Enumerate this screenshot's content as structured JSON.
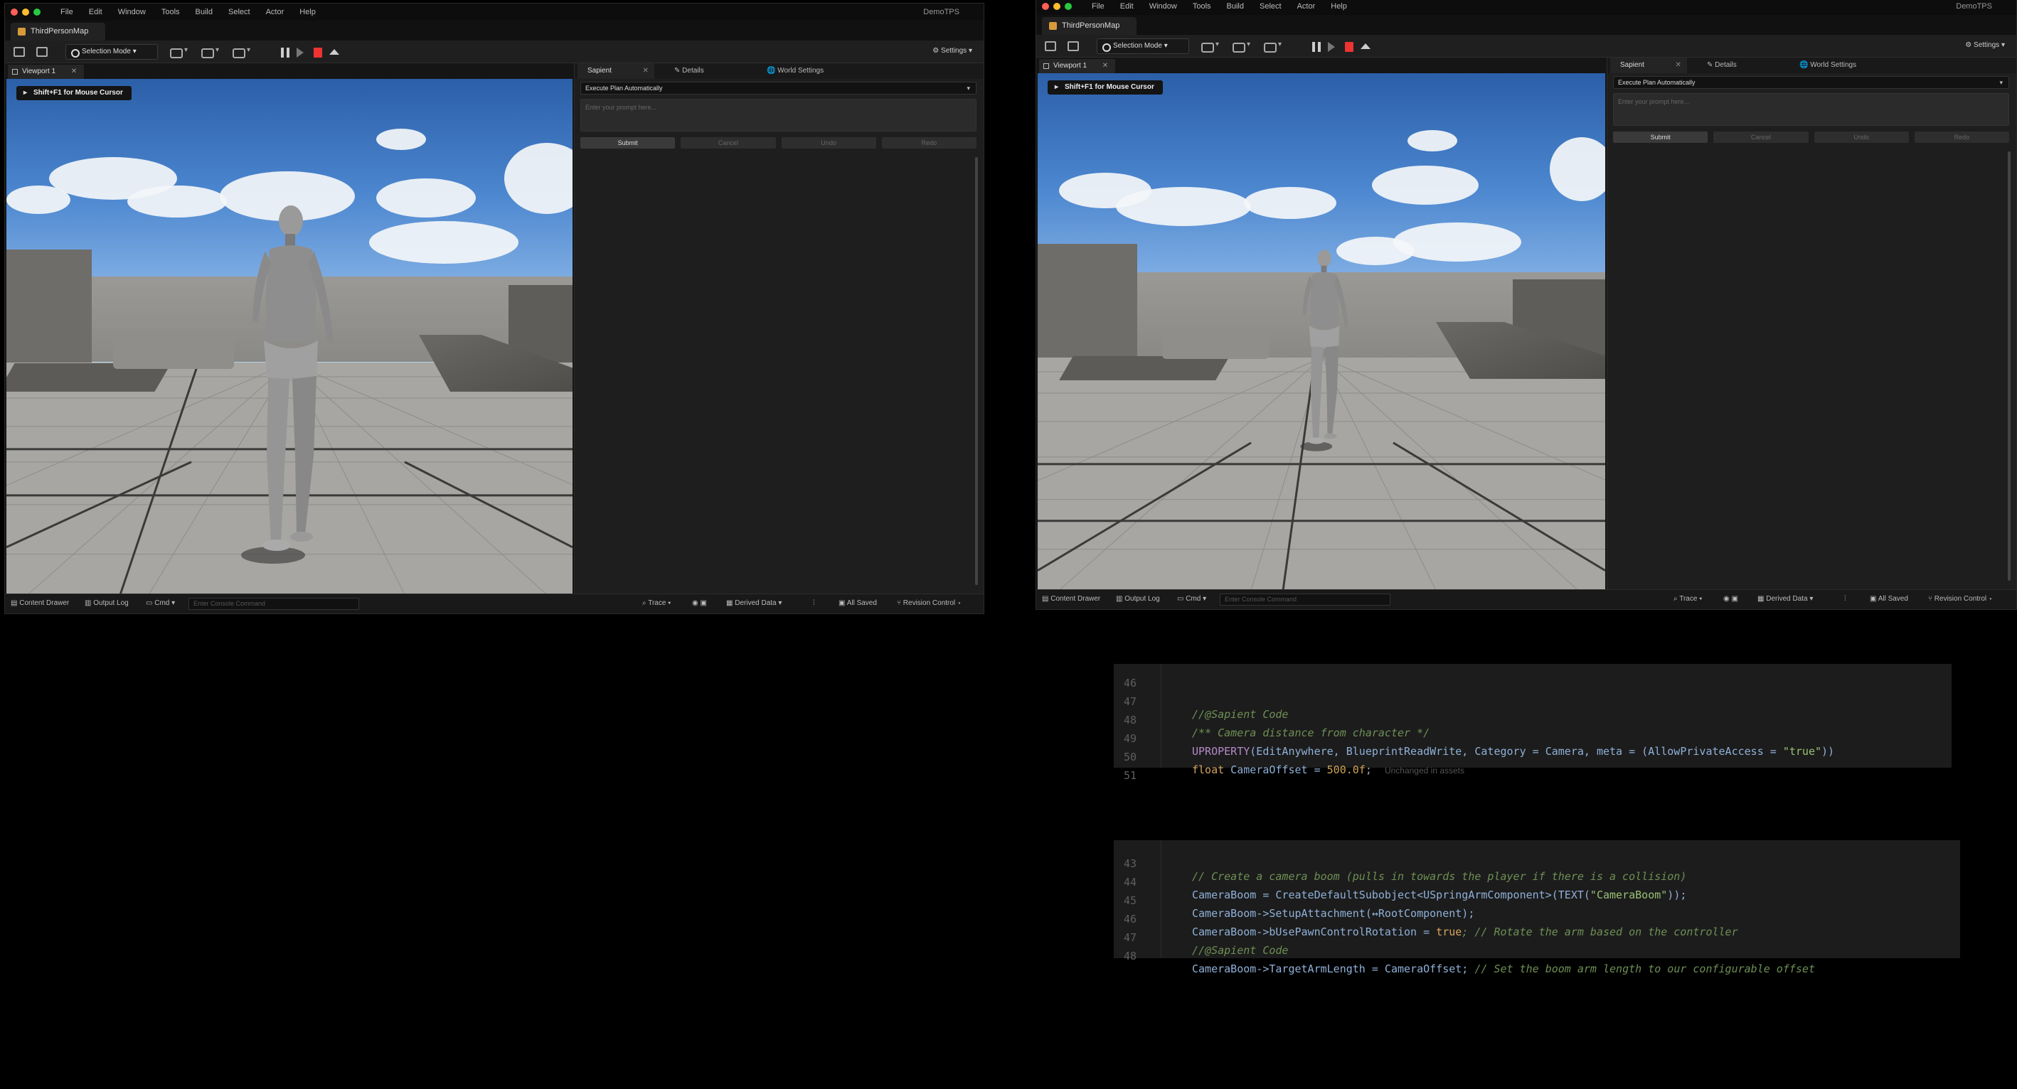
{
  "editors": [
    {
      "app_title": "DemoTPS",
      "menu": [
        "File",
        "Edit",
        "Window",
        "Tools",
        "Build",
        "Select",
        "Actor",
        "Help"
      ],
      "map_tab": "ThirdPersonMap",
      "toolbar": {
        "mode": "Selection Mode",
        "settings": "Settings"
      },
      "viewport_tab": "Viewport 1",
      "overlay_hint": "Shift+F1 for Mouse Cursor",
      "panel": {
        "tabs": [
          "Sapient",
          "Details",
          "World Settings"
        ],
        "dropdown": "Execute Plan Automatically",
        "prompt_placeholder": "Enter your prompt here...",
        "buttons": [
          "Submit",
          "Cancel",
          "Undo",
          "Redo"
        ]
      },
      "statusbar": {
        "content_drawer": "Content Drawer",
        "output_log": "Output Log",
        "cmd": "Cmd",
        "console_placeholder": "Enter Console Command",
        "trace": "Trace",
        "derived_data": "Derived Data",
        "all_saved": "All Saved",
        "revision_control": "Revision Control"
      }
    },
    {
      "app_title": "DemoTPS",
      "menu": [
        "File",
        "Edit",
        "Window",
        "Tools",
        "Build",
        "Select",
        "Actor",
        "Help"
      ],
      "map_tab": "ThirdPersonMap",
      "toolbar": {
        "mode": "Selection Mode",
        "settings": "Settings"
      },
      "viewport_tab": "Viewport 1",
      "overlay_hint": "Shift+F1 for Mouse Cursor",
      "panel": {
        "tabs": [
          "Sapient",
          "Details",
          "World Settings"
        ],
        "dropdown": "Execute Plan Automatically",
        "prompt_placeholder": "Enter your prompt here...",
        "buttons": [
          "Submit",
          "Cancel",
          "Undo",
          "Redo"
        ]
      },
      "statusbar": {
        "content_drawer": "Content Drawer",
        "output_log": "Output Log",
        "cmd": "Cmd",
        "console_placeholder": "Enter Console Command",
        "trace": "Trace",
        "derived_data": "Derived Data",
        "all_saved": "All Saved",
        "revision_control": "Revision Control"
      }
    }
  ],
  "code_header": {
    "lines": [
      {
        "n": "46",
        "text": ""
      },
      {
        "n": "47",
        "text": "//@Sapient Code"
      },
      {
        "n": "48",
        "text": "/** Camera distance from character */"
      },
      {
        "n": "49",
        "p1": "UPROPERTY",
        "p2": "(EditAnywhere, BlueprintReadWrite, Category = Camera, meta = (AllowPrivateAccess = ",
        "p3": "\"true\"",
        "p4": "))"
      },
      {
        "n": "50",
        "p1": "float",
        "p2": " CameraOffset = ",
        "p3": "500.0f",
        "p4": ";",
        "hint": "Unchanged in assets"
      },
      {
        "n": "51",
        "text": ""
      }
    ]
  },
  "code_source": {
    "lines": [
      {
        "n": "43",
        "text": "// Create a camera boom (pulls in towards the player if there is a collision)"
      },
      {
        "n": "44",
        "p1": "CameraBoom = CreateDefaultSubobject<USpringArmComponent>(TEXT(",
        "p2": "\"CameraBoom\"",
        "p3": "));"
      },
      {
        "n": "45",
        "text": "CameraBoom->SetupAttachment(↔RootComponent);"
      },
      {
        "n": "46",
        "p1": "CameraBoom->bUsePawnControlRotation = ",
        "p2": "true",
        "p3": "; // Rotate the arm based on the controller"
      },
      {
        "n": "47",
        "text": "//@Sapient Code"
      },
      {
        "n": "48",
        "p1": "CameraBoom->TargetArmLength = CameraOffset; ",
        "p2": "// Set the boom arm length to our configurable offset"
      }
    ]
  }
}
